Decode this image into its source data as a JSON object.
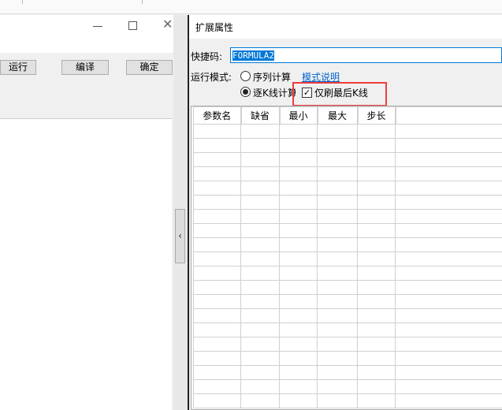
{
  "left_window": {
    "buttons": {
      "run": "运行",
      "compile": "编译",
      "ok": "确定"
    }
  },
  "dialog": {
    "title": "扩展属性",
    "shortcut_label": "快捷码:",
    "shortcut_value": "FORMULA2",
    "run_mode_label": "运行模式:",
    "mode_sequence": "序列计算",
    "mode_help_link": "模式说明",
    "mode_per_bar": "逐K线计算",
    "refresh_last_only": "仅刷最后K线",
    "refresh_last_only_checked": true,
    "selected_mode": "per_bar",
    "table": {
      "columns": [
        "参数名",
        "缺省",
        "最小",
        "最大",
        "步长",
        ""
      ],
      "rows": 20
    },
    "highlight_color": "#f03c3c"
  }
}
